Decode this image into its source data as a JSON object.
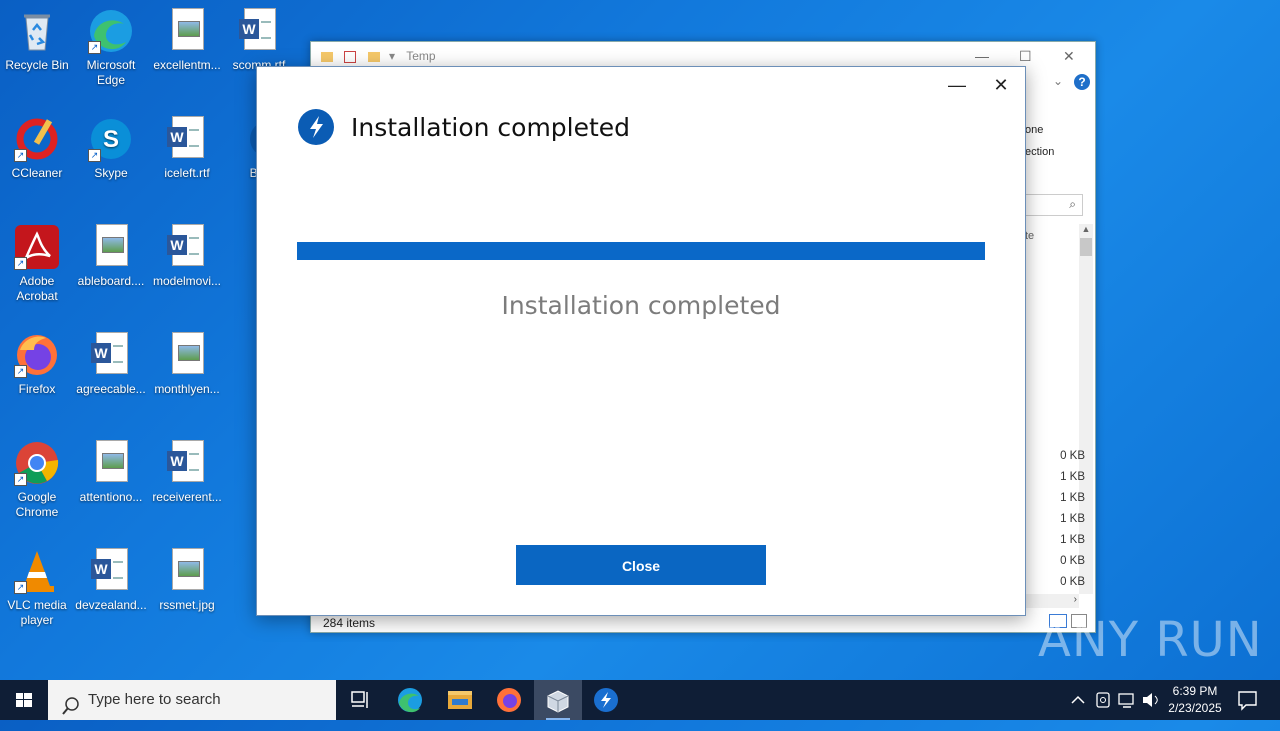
{
  "desktop": {
    "icons": [
      {
        "label": "Recycle Bin"
      },
      {
        "label": "Microsoft Edge"
      },
      {
        "label": "excellentm..."
      },
      {
        "label": "scomm.rtf"
      },
      {
        "label": "CCleaner"
      },
      {
        "label": "Skype"
      },
      {
        "label": "iceleft.rtf"
      },
      {
        "label": "Bar"
      },
      {
        "label": "Adobe Acrobat"
      },
      {
        "label": "ableboard...."
      },
      {
        "label": "modelmovi..."
      },
      {
        "label": "Firefox"
      },
      {
        "label": "agreecable..."
      },
      {
        "label": "monthlyen..."
      },
      {
        "label": "Google Chrome"
      },
      {
        "label": "attentiono..."
      },
      {
        "label": "receiverent..."
      },
      {
        "label": "VLC media player"
      },
      {
        "label": "devzealand..."
      },
      {
        "label": "rssmet.jpg"
      }
    ]
  },
  "explorer": {
    "title": "Temp",
    "ribbon_fragments": [
      "one",
      "ection"
    ],
    "col_fragment": "te",
    "sizes": [
      "0 KB",
      "1 KB",
      "1 KB",
      "1 KB",
      "1 KB",
      "0 KB",
      "0 KB"
    ],
    "status": "284 items"
  },
  "dialog": {
    "title": "Installation completed",
    "status_text": "Installation completed",
    "progress": 1.0,
    "close_label": "Close",
    "accent": "#0a66c2"
  },
  "watermark": {
    "text": "ANY RUN"
  },
  "taskbar": {
    "search_placeholder": "Type here to search",
    "time": "6:39 PM",
    "date": "2/23/2025"
  }
}
